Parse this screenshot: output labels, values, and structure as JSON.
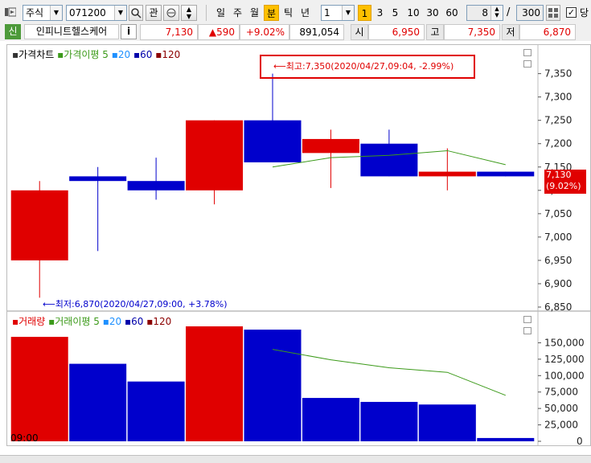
{
  "toolbar": {
    "market_type": "주식",
    "stock_code": "071200",
    "search_icon": "magnifier-icon",
    "watch_label": "관",
    "period_buttons": [
      "일",
      "주",
      "월",
      "분",
      "틱",
      "년"
    ],
    "selected_period": "분",
    "interval_value": "1",
    "minute_buttons": [
      "1",
      "3",
      "5",
      "10",
      "30",
      "60"
    ],
    "selected_minute": "1",
    "count_value": "8",
    "total_count": "300",
    "separator": "/",
    "checkbox_label": "당"
  },
  "quote": {
    "badge": "신",
    "name": "인피니트헬스케어",
    "info": "i",
    "price": "7,130",
    "change": "▲590",
    "change_pct": "+9.02%",
    "volume": "891,054",
    "open_label": "시",
    "open": "6,950",
    "high_label": "고",
    "high": "7,350",
    "low_label": "저",
    "low": "6,870"
  },
  "price_panel": {
    "legend_title": "가격차트",
    "ma_label": "가격이평",
    "ma_periods": [
      "5",
      "20",
      "60",
      "120"
    ],
    "high_annotation": "⟵최고:7,350(2020/04/27,09:04, -2.99%)",
    "low_annotation": "⟵최저:6,870(2020/04/27,09:00, +3.78%)",
    "current_price_tag": "7,130",
    "current_pct_tag": "(9.02%)",
    "y_ticks": [
      "7,350",
      "7,300",
      "7,250",
      "7,200",
      "7,150",
      "7,100",
      "7,050",
      "7,000",
      "6,950",
      "6,900",
      "6,850"
    ]
  },
  "volume_panel": {
    "legend_title": "거래량",
    "ma_label": "거래이평",
    "ma_periods": [
      "5",
      "20",
      "60",
      "120"
    ],
    "y_ticks": [
      "150,000",
      "125,000",
      "100,000",
      "75,000",
      "50,000",
      "25,000",
      "0"
    ]
  },
  "time_label": "09:00",
  "colors": {
    "up": "#e00000",
    "down": "#0000cc",
    "ma5": "#3c9a1a",
    "ma20": "#1e90ff",
    "ma60": "#0000aa",
    "ma120": "#8b0000",
    "highlight_box": "#e00000"
  },
  "chart_data": [
    {
      "type": "candlestick",
      "title": "가격차트",
      "ylim": [
        6850,
        7370
      ],
      "candles": [
        {
          "open": 6950,
          "high": 7120,
          "low": 6870,
          "close": 7100
        },
        {
          "open": 7130,
          "high": 7150,
          "low": 6970,
          "close": 7120
        },
        {
          "open": 7120,
          "high": 7170,
          "low": 7080,
          "close": 7100
        },
        {
          "open": 7100,
          "high": 7250,
          "low": 7070,
          "close": 7250
        },
        {
          "open": 7250,
          "high": 7350,
          "low": 7160,
          "close": 7160
        },
        {
          "open": 7180,
          "high": 7230,
          "low": 7105,
          "close": 7210
        },
        {
          "open": 7200,
          "high": 7230,
          "low": 7130,
          "close": 7130
        },
        {
          "open": 7130,
          "high": 7190,
          "low": 7100,
          "close": 7140
        },
        {
          "open": 7140,
          "high": 7140,
          "low": 7130,
          "close": 7130
        }
      ],
      "ma5": [
        null,
        null,
        null,
        null,
        7150,
        7170,
        7175,
        7185,
        7155
      ]
    },
    {
      "type": "bar",
      "title": "거래량",
      "ylim": [
        0,
        175000
      ],
      "values": [
        159000,
        118000,
        91000,
        175000,
        170000,
        66000,
        60000,
        56000,
        5000
      ],
      "colors": [
        "up",
        "down",
        "down",
        "up",
        "down",
        "down",
        "down",
        "down",
        "down"
      ],
      "ma5": [
        null,
        null,
        null,
        null,
        140000,
        124000,
        112000,
        105000,
        70000
      ]
    }
  ]
}
